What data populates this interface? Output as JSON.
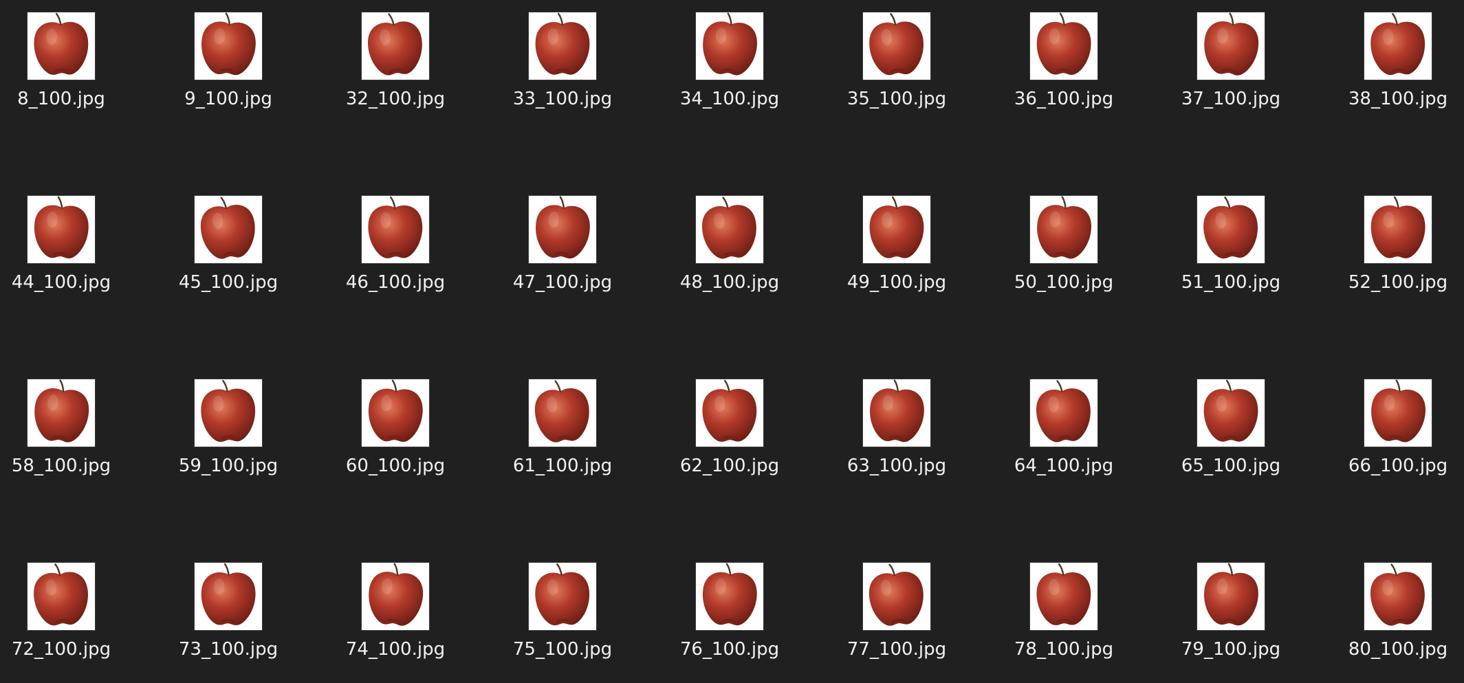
{
  "files": [
    {
      "name": "8_100.jpg"
    },
    {
      "name": "9_100.jpg"
    },
    {
      "name": "32_100.jpg"
    },
    {
      "name": "33_100.jpg"
    },
    {
      "name": "34_100.jpg"
    },
    {
      "name": "35_100.jpg"
    },
    {
      "name": "36_100.jpg"
    },
    {
      "name": "37_100.jpg"
    },
    {
      "name": "38_100.jpg"
    },
    {
      "name": "44_100.jpg"
    },
    {
      "name": "45_100.jpg"
    },
    {
      "name": "46_100.jpg"
    },
    {
      "name": "47_100.jpg"
    },
    {
      "name": "48_100.jpg"
    },
    {
      "name": "49_100.jpg"
    },
    {
      "name": "50_100.jpg"
    },
    {
      "name": "51_100.jpg"
    },
    {
      "name": "52_100.jpg"
    },
    {
      "name": "58_100.jpg"
    },
    {
      "name": "59_100.jpg"
    },
    {
      "name": "60_100.jpg"
    },
    {
      "name": "61_100.jpg"
    },
    {
      "name": "62_100.jpg"
    },
    {
      "name": "63_100.jpg"
    },
    {
      "name": "64_100.jpg"
    },
    {
      "name": "65_100.jpg"
    },
    {
      "name": "66_100.jpg"
    },
    {
      "name": "72_100.jpg"
    },
    {
      "name": "73_100.jpg"
    },
    {
      "name": "74_100.jpg"
    },
    {
      "name": "75_100.jpg"
    },
    {
      "name": "76_100.jpg"
    },
    {
      "name": "77_100.jpg"
    },
    {
      "name": "78_100.jpg"
    },
    {
      "name": "79_100.jpg"
    },
    {
      "name": "80_100.jpg"
    }
  ],
  "colors": {
    "background": "#202020",
    "apple_red": "#b23a2a",
    "apple_highlight": "#e07a5a",
    "apple_shadow": "#6e1e16",
    "stem": "#4a3a28"
  }
}
